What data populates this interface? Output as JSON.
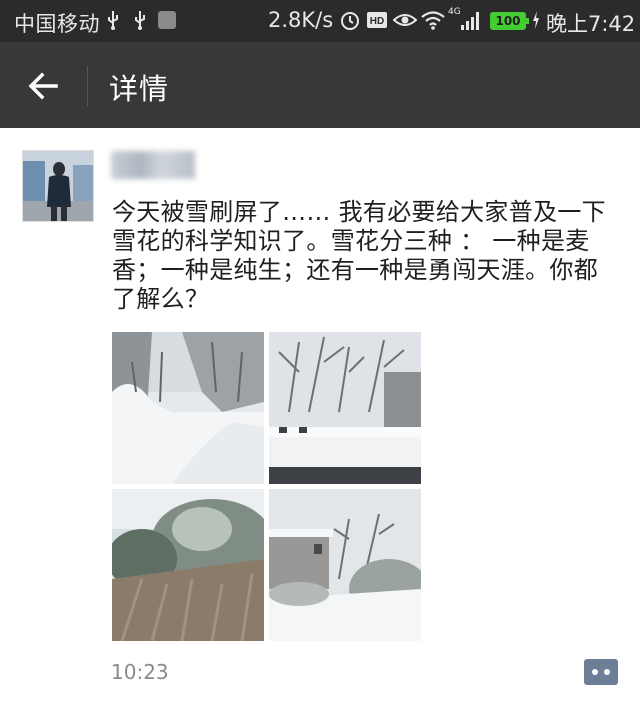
{
  "status_bar": {
    "carrier": "中国移动",
    "net_speed": "2.8K/s",
    "network_type": "4G",
    "battery": "100",
    "time": "晚上7:42",
    "battery_color": "#44cc33"
  },
  "header": {
    "title": "详情",
    "back_icon": "arrow-left-icon"
  },
  "post": {
    "username": "",
    "text": "今天被雪刷屏了…… 我有必要给大家普及一下雪花的科学知识了。雪花分三种 ： 一种是麦香；一种是纯生；还有一种是勇闯天涯。你都了解么？",
    "time": "10:23",
    "images": [
      "snowy-road-photo",
      "snowy-rooftop-photo",
      "frosted-bushes-photo",
      "snowy-house-photo"
    ],
    "comment_icon": "comment-icon",
    "comment_color": "#6d7f96"
  }
}
